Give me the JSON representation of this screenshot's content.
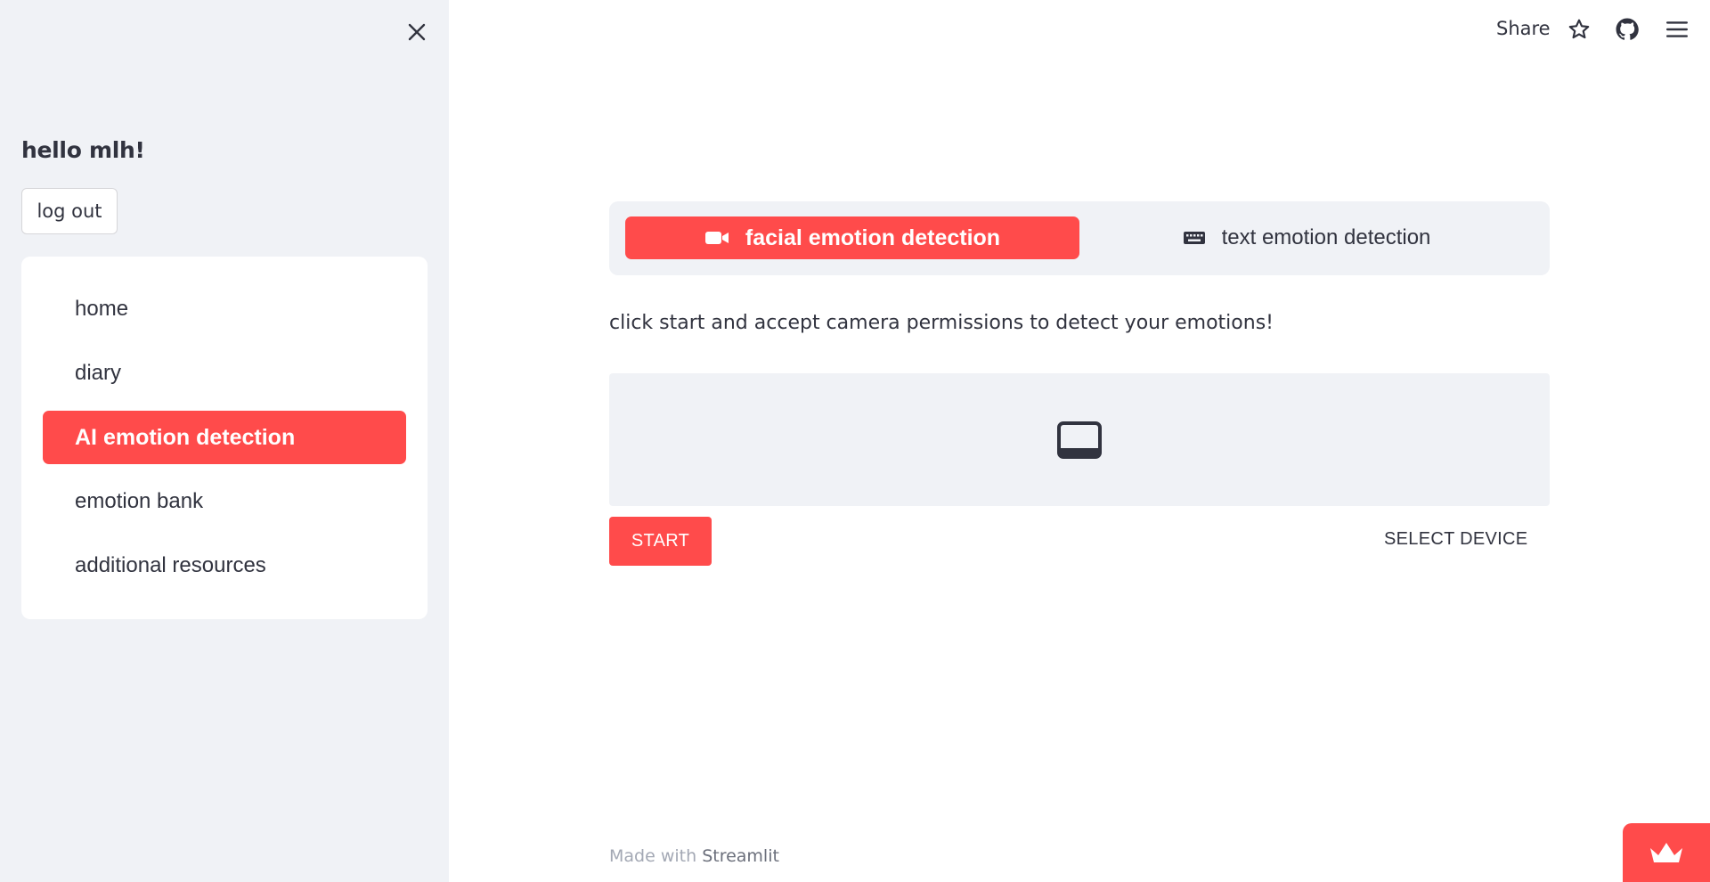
{
  "sidebar": {
    "greeting": "hello mlh!",
    "logout_label": "log out",
    "nav": [
      {
        "label": "home",
        "active": false
      },
      {
        "label": "diary",
        "active": false
      },
      {
        "label": "AI emotion detection",
        "active": true
      },
      {
        "label": "emotion bank",
        "active": false
      },
      {
        "label": "additional resources",
        "active": false
      }
    ]
  },
  "topbar": {
    "share_label": "Share",
    "icons": [
      "star-icon",
      "github-icon",
      "hamburger-menu-icon"
    ]
  },
  "tabs": [
    {
      "label": "facial emotion detection",
      "icon": "video-camera-icon",
      "active": true
    },
    {
      "label": "text emotion detection",
      "icon": "keyboard-icon",
      "active": false
    }
  ],
  "main": {
    "instructions": "click start and accept camera permissions to detect your emotions!",
    "video_placeholder_icon": "laptop-icon",
    "start_label": "START",
    "select_device_label": "SELECT DEVICE"
  },
  "footer": {
    "made_with": "Made with ",
    "brand": "Streamlit"
  },
  "colors": {
    "accent": "#ff4b4b",
    "sidebar_bg": "#f0f2f6",
    "text": "#31333f"
  }
}
